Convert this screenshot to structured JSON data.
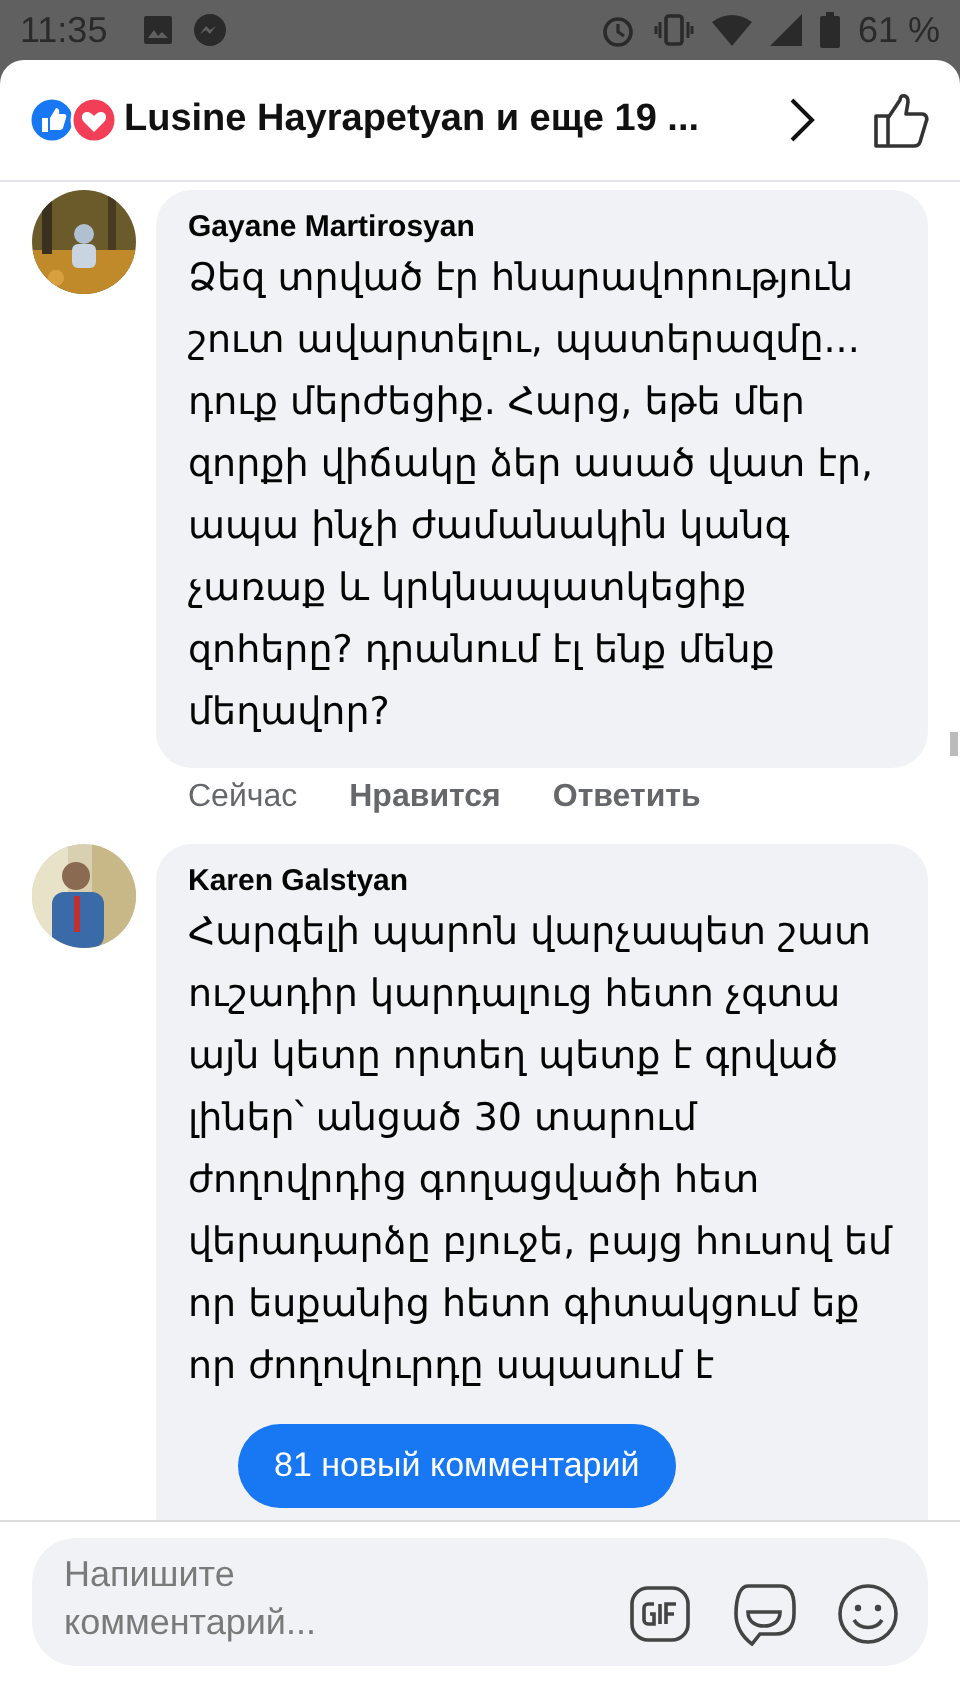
{
  "status_bar": {
    "time": "11:35",
    "battery": "61 %"
  },
  "header": {
    "reaction_summary": "Lusine Hayrapetyan и еще 19 ..."
  },
  "comments": [
    {
      "author": "Gayane Martirosyan",
      "text": "Ձեզ տրված էր հնարավորություն շուտ ավարտելու, պատերազմը... դուք մերժեցիք. Հարց, եթե մեր զորքի վիճակը ձեր ասած վատ էր, ապա ինչի ժամանակին կանգ չառաք և կրկնապատկեցիք զոհերը? դրանում էլ ենք մենք մեղավոր?",
      "time": "Сейчас",
      "actions": [
        "Нравится",
        "Ответить"
      ]
    },
    {
      "author": "Karen Galstyan",
      "text": "Հարգելի պարոն վարչապետ շատ ուշադիր կարդալուց հետո չգտա այն կետը որտեղ պետք է գրված լիներ՝ անցած 30 տարում ժողովրդից գողացվածի հետ վերադարձը բյուջե, բայց հուսով եմ որ եսքանից հետո գիտակցում եք որ ժողովուրդը սպասում է"
    }
  ],
  "new_comments_button": "81 новый комментарий",
  "composer": {
    "placeholder": "Напишите комментарий..."
  }
}
